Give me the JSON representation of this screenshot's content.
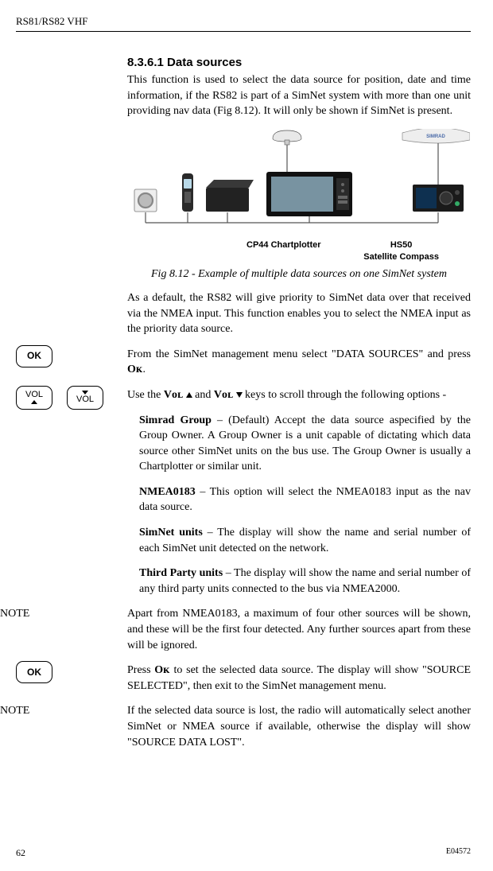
{
  "header": "RS81/RS82 VHF",
  "section_number_title": "8.3.6.1  Data sources",
  "intro_para": "This function is used to select the data source for position, date and time information, if the RS82 is part of a SimNet system with more than one unit providing nav data (Fig 8.12). It will only be shown if SimNet is present.",
  "diagram_labels": {
    "cp44": "CP44 Chartplotter",
    "hs50_line1": "HS50",
    "hs50_line2": "Satellite Compass",
    "simrad": "SIMRAD"
  },
  "fig_caption": "Fig 8.12 - Example of multiple data sources on one SimNet system",
  "default_para": "As a default, the RS82 will give priority to SimNet data over that received via the NMEA input. This function enables you to select the NMEA input as the priority data source.",
  "from_simnet_pre": "From the SimNet management menu select \"DATA SOURCES\" and press ",
  "ok_label": "Oᴋ",
  "period": ".",
  "use_vol_pre": "Use the ",
  "vol_label": "Vᴏʟ",
  "use_vol_mid": " and ",
  "use_vol_post": " keys to scroll through the following options -",
  "simrad_group_b": "Simrad Group",
  "simrad_group_txt": " – (Default) Accept the data source aspecified by the Group Owner. A Group Owner is a unit capable of dictating which data source other SimNet units on the bus use. The Group Owner is usually a Chartplotter or similar unit.",
  "nmea_b": "NMEA0183",
  "nmea_txt": " – This option will select the NMEA0183 input as the nav data source.",
  "simnet_units_b": "SimNet units",
  "simnet_units_txt": " – The display will show the name and serial number of each SimNet unit detected on the network.",
  "third_party_b": "Third Party units",
  "third_party_txt": "  – The display will show the name and serial number of any third party units connected to the bus via NMEA2000.",
  "note_label": "NOTE",
  "note1": "Apart from NMEA0183, a maximum of four other sources will be shown, and these will be the first four detected. Any further sources apart from these will be ignored.",
  "press_ok_pre": "Press ",
  "press_ok_post": " to set the selected data source. The display will show \"SOURCE SELECTED\", then exit to the SimNet management menu.",
  "note2": "If the selected data source is lost, the radio will automatically select another SimNet or NMEA source if available, otherwise the display will show \"SOURCE DATA LOST\".",
  "buttons": {
    "ok": "OK",
    "vol": "VOL"
  },
  "page_number": "62",
  "doc_number": "E04572"
}
